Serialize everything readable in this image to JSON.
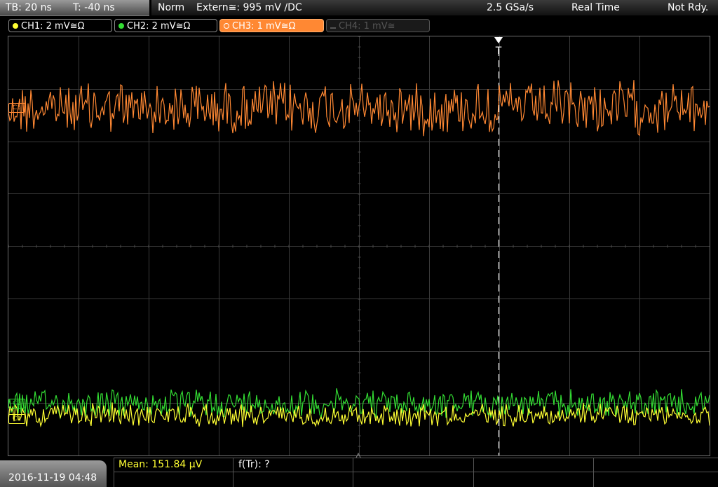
{
  "topbar": {
    "timebase": "TB: 20 ns",
    "trigger_offset": "T: -40 ns",
    "trigger_mode": "Norm",
    "trigger_source": "Extern≅: 995 mV ∕DC",
    "sample_rate": "2.5 GSa/s",
    "acq_mode": "Real Time",
    "status": "Not Rdy."
  },
  "channels": [
    {
      "label": "CH1: 2 mV≅Ω",
      "color": "#ffff33",
      "state": "on"
    },
    {
      "label": "CH2: 2 mV≅Ω",
      "color": "#33dd33",
      "state": "on"
    },
    {
      "label": "CH3: 1 mV≅Ω",
      "color": "#ff8833",
      "state": "selected"
    },
    {
      "label": "CH4: 1 mV≅",
      "color": "#555555",
      "state": "off"
    }
  ],
  "trigger_marker": "T",
  "markers": {
    "ch3": "C3",
    "ch2": "C2",
    "ch1": "C1"
  },
  "bottom": {
    "datetime": "2016-11-19 04:48",
    "measurement": "Mean: 151.84 µV",
    "measurement_color": "#ffff33",
    "function": "f(Tr): ?"
  }
}
